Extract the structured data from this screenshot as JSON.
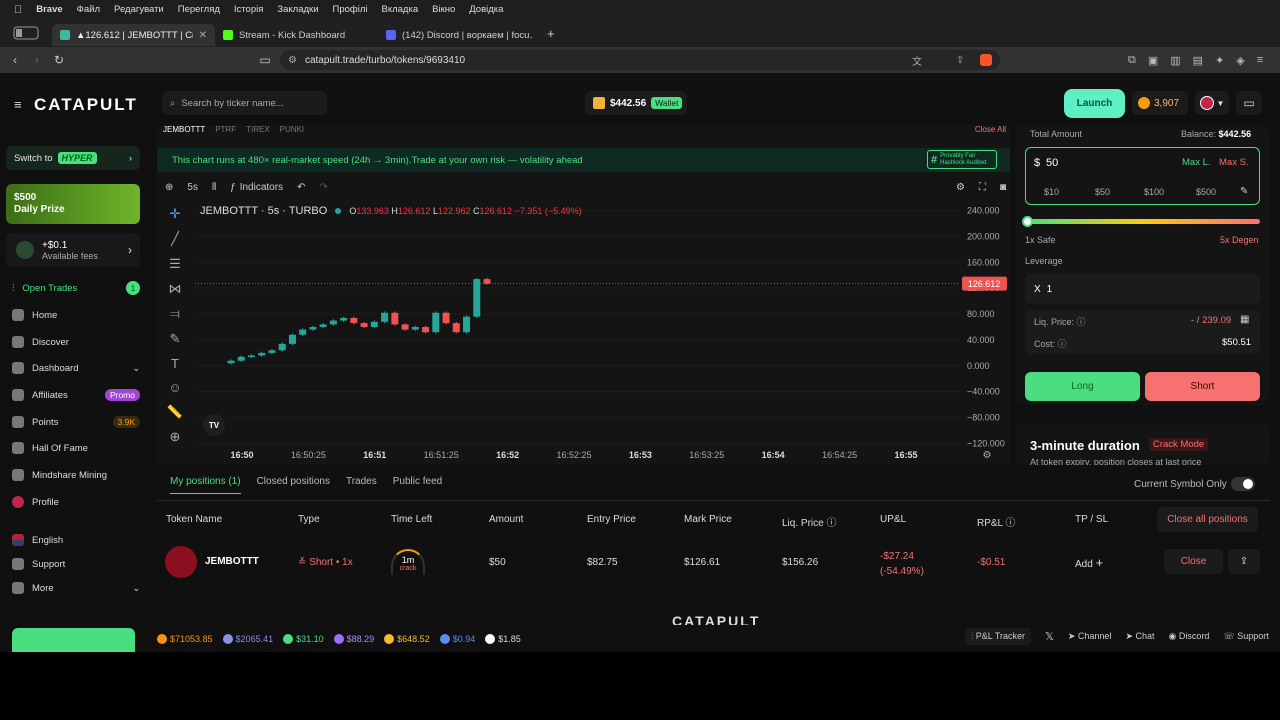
{
  "os_menu": {
    "apple": "",
    "app": "Brave",
    "items": [
      "Файл",
      "Редагувати",
      "Перегляд",
      "Історія",
      "Закладки",
      "Профілі",
      "Вкладка",
      "Вікно",
      "Довідка"
    ]
  },
  "browser": {
    "tabs": [
      {
        "label": "▲126.612 | JEMBOTTT | Crac…",
        "active": true,
        "favicon_color": "#3fb8a0"
      },
      {
        "label": "Stream - Kick Dashboard",
        "active": false,
        "favicon_color": "#53fc18"
      },
      {
        "label": "(142) Discord | воркаем | focu…",
        "active": false,
        "favicon_color": "#5865f2"
      }
    ],
    "new_tab": "+",
    "url": "catapult.trade/turbo/tokens/9693410"
  },
  "header": {
    "logo": "CATAPULT",
    "search_placeholder": "Search by ticker name...",
    "balance": "$442.56",
    "wallet_label": "Wallet",
    "launch_label": "Launch",
    "points": "3,907"
  },
  "sidebar": {
    "switch_to": "Switch to",
    "hyper": "HYPER",
    "prize_amount": "$500",
    "prize_label": "Daily Prize",
    "fees_amount": "+$0.1",
    "fees_label": "Available fees",
    "open_trades": "Open Trades",
    "open_trades_count": "1",
    "items": [
      {
        "label": "Home",
        "icon": "home-icon"
      },
      {
        "label": "Discover",
        "icon": "discover-icon"
      },
      {
        "label": "Dashboard",
        "icon": "dashboard-icon"
      },
      {
        "label": "Affiliates",
        "icon": "affiliates-icon",
        "badge": "Promo"
      },
      {
        "label": "Points",
        "icon": "points-icon",
        "badge": "3.9K"
      },
      {
        "label": "Hall Of Fame",
        "icon": "trophy-icon"
      },
      {
        "label": "Mindshare Mining",
        "icon": "mining-icon"
      },
      {
        "label": "Profile",
        "icon": "profile-icon"
      }
    ],
    "language": "English",
    "support": "Support",
    "more": "More"
  },
  "chart": {
    "symbol_tabs": [
      "JEMBOTTT",
      "PTRF",
      "TIREX",
      "PUNKI"
    ],
    "close_all_tabs": "Close All",
    "banner": "This chart runs at 480× real-market speed (24h → 3min).Trade at your own risk — volatility ahead",
    "hash_badge_line1": "Provably Fair",
    "hash_badge_line2": "Hashlock Audited",
    "interval": "5s",
    "indicators_label": "Indicators",
    "title": "JEMBOTTT · 5s · TURBO",
    "ohlc": {
      "o": "133.963",
      "h": "126.612",
      "l": "122.962",
      "c": "126.612",
      "change": "−7.351 (−5.49%)"
    },
    "last_price": "126.612",
    "y_ticks": [
      "240.000",
      "200.000",
      "160.000",
      "120.000",
      "80.000",
      "40.000",
      "0.000",
      "−40.000",
      "−80.000",
      "−120.000"
    ],
    "x_ticks": [
      "16:50",
      "16:50:25",
      "16:51",
      "16:51:25",
      "16:52",
      "16:52:25",
      "16:53",
      "16:53:25",
      "16:54",
      "16:54:25",
      "16:55"
    ],
    "tv_logo": "TV"
  },
  "chart_data": {
    "type": "candlestick",
    "ylim": [
      -130,
      250
    ],
    "candles": [
      {
        "o": 4,
        "c": 8
      },
      {
        "o": 8,
        "c": 14
      },
      {
        "o": 14,
        "c": 16
      },
      {
        "o": 16,
        "c": 20
      },
      {
        "o": 20,
        "c": 24
      },
      {
        "o": 24,
        "c": 34
      },
      {
        "o": 34,
        "c": 48
      },
      {
        "o": 48,
        "c": 56
      },
      {
        "o": 56,
        "c": 60
      },
      {
        "o": 60,
        "c": 64
      },
      {
        "o": 64,
        "c": 70
      },
      {
        "o": 70,
        "c": 74
      },
      {
        "o": 74,
        "c": 66
      },
      {
        "o": 66,
        "c": 60
      },
      {
        "o": 60,
        "c": 68
      },
      {
        "o": 68,
        "c": 82
      },
      {
        "o": 82,
        "c": 64
      },
      {
        "o": 64,
        "c": 56
      },
      {
        "o": 56,
        "c": 60
      },
      {
        "o": 60,
        "c": 52
      },
      {
        "o": 52,
        "c": 82
      },
      {
        "o": 82,
        "c": 66
      },
      {
        "o": 66,
        "c": 52
      },
      {
        "o": 52,
        "c": 76
      },
      {
        "o": 76,
        "c": 134
      },
      {
        "o": 134,
        "c": 127
      }
    ]
  },
  "trade_panel": {
    "total_amount_label": "Total Amount",
    "balance_label": "Balance:",
    "balance_value": "$442.56",
    "currency": "$",
    "amount": "50",
    "max_long": "Max L.",
    "max_short": "Max S.",
    "presets": [
      "$10",
      "$50",
      "$100",
      "$500"
    ],
    "safe": "1x Safe",
    "degen": "5x Degen",
    "leverage_label": "Leverage",
    "leverage_x": "X",
    "leverage_value": "1",
    "liq_label": "Liq. Price:",
    "liq_value_prefix": "- /",
    "liq_value": "239.09",
    "cost_label": "Cost:",
    "cost_value": "$50.51",
    "long_label": "Long",
    "short_label": "Short",
    "duration_title": "3-minute duration",
    "crack_mode": "Crack Mode",
    "duration_note": "At token expiry, position closes at last price"
  },
  "positions": {
    "tabs": [
      "My positions (1)",
      "Closed positions",
      "Trades",
      "Public feed"
    ],
    "current_symbol_only": "Current Symbol Only",
    "headers": [
      "Token Name",
      "Type",
      "Time Left",
      "Amount",
      "Entry Price",
      "Mark Price",
      "Liq. Price",
      "UP&L",
      "RP&L",
      "TP / SL"
    ],
    "close_all": "Close all positions",
    "row": {
      "token": "JEMBOTTT",
      "type": "Short • 1x",
      "time_left": "1m",
      "time_left_sub": "crack",
      "amount": "$50",
      "entry": "$82.75",
      "mark": "$126.61",
      "liq": "$156.26",
      "upnl": "-$27.24",
      "upnl_pct": "(-54.49%)",
      "rpnl": "-$0.51",
      "tpsl": "Add",
      "close": "Close"
    }
  },
  "footer": {
    "logo": "CATAPULT",
    "tickers": [
      {
        "value": "$71053.85",
        "color": "#f7931a",
        "text_color": "#f7931a"
      },
      {
        "value": "$2065.41",
        "color": "#8a8fe0",
        "text_color": "#8a8fe0"
      },
      {
        "value": "$31.10",
        "color": "#4ade80",
        "text_color": "#4ade80"
      },
      {
        "value": "$88.29",
        "color": "#9b6cff",
        "text_color": "#b08aff"
      },
      {
        "value": "$648.52",
        "color": "#f3ba2f",
        "text_color": "#f3ba2f"
      },
      {
        "value": "$0.94",
        "color": "#5b8def",
        "text_color": "#5b8def"
      },
      {
        "value": "$1.85",
        "color": "#ffffff",
        "text_color": "#dddddd"
      }
    ],
    "pnl_tracker": "P&L Tracker",
    "links": [
      "Channel",
      "Chat",
      "Discord",
      "Support"
    ]
  }
}
